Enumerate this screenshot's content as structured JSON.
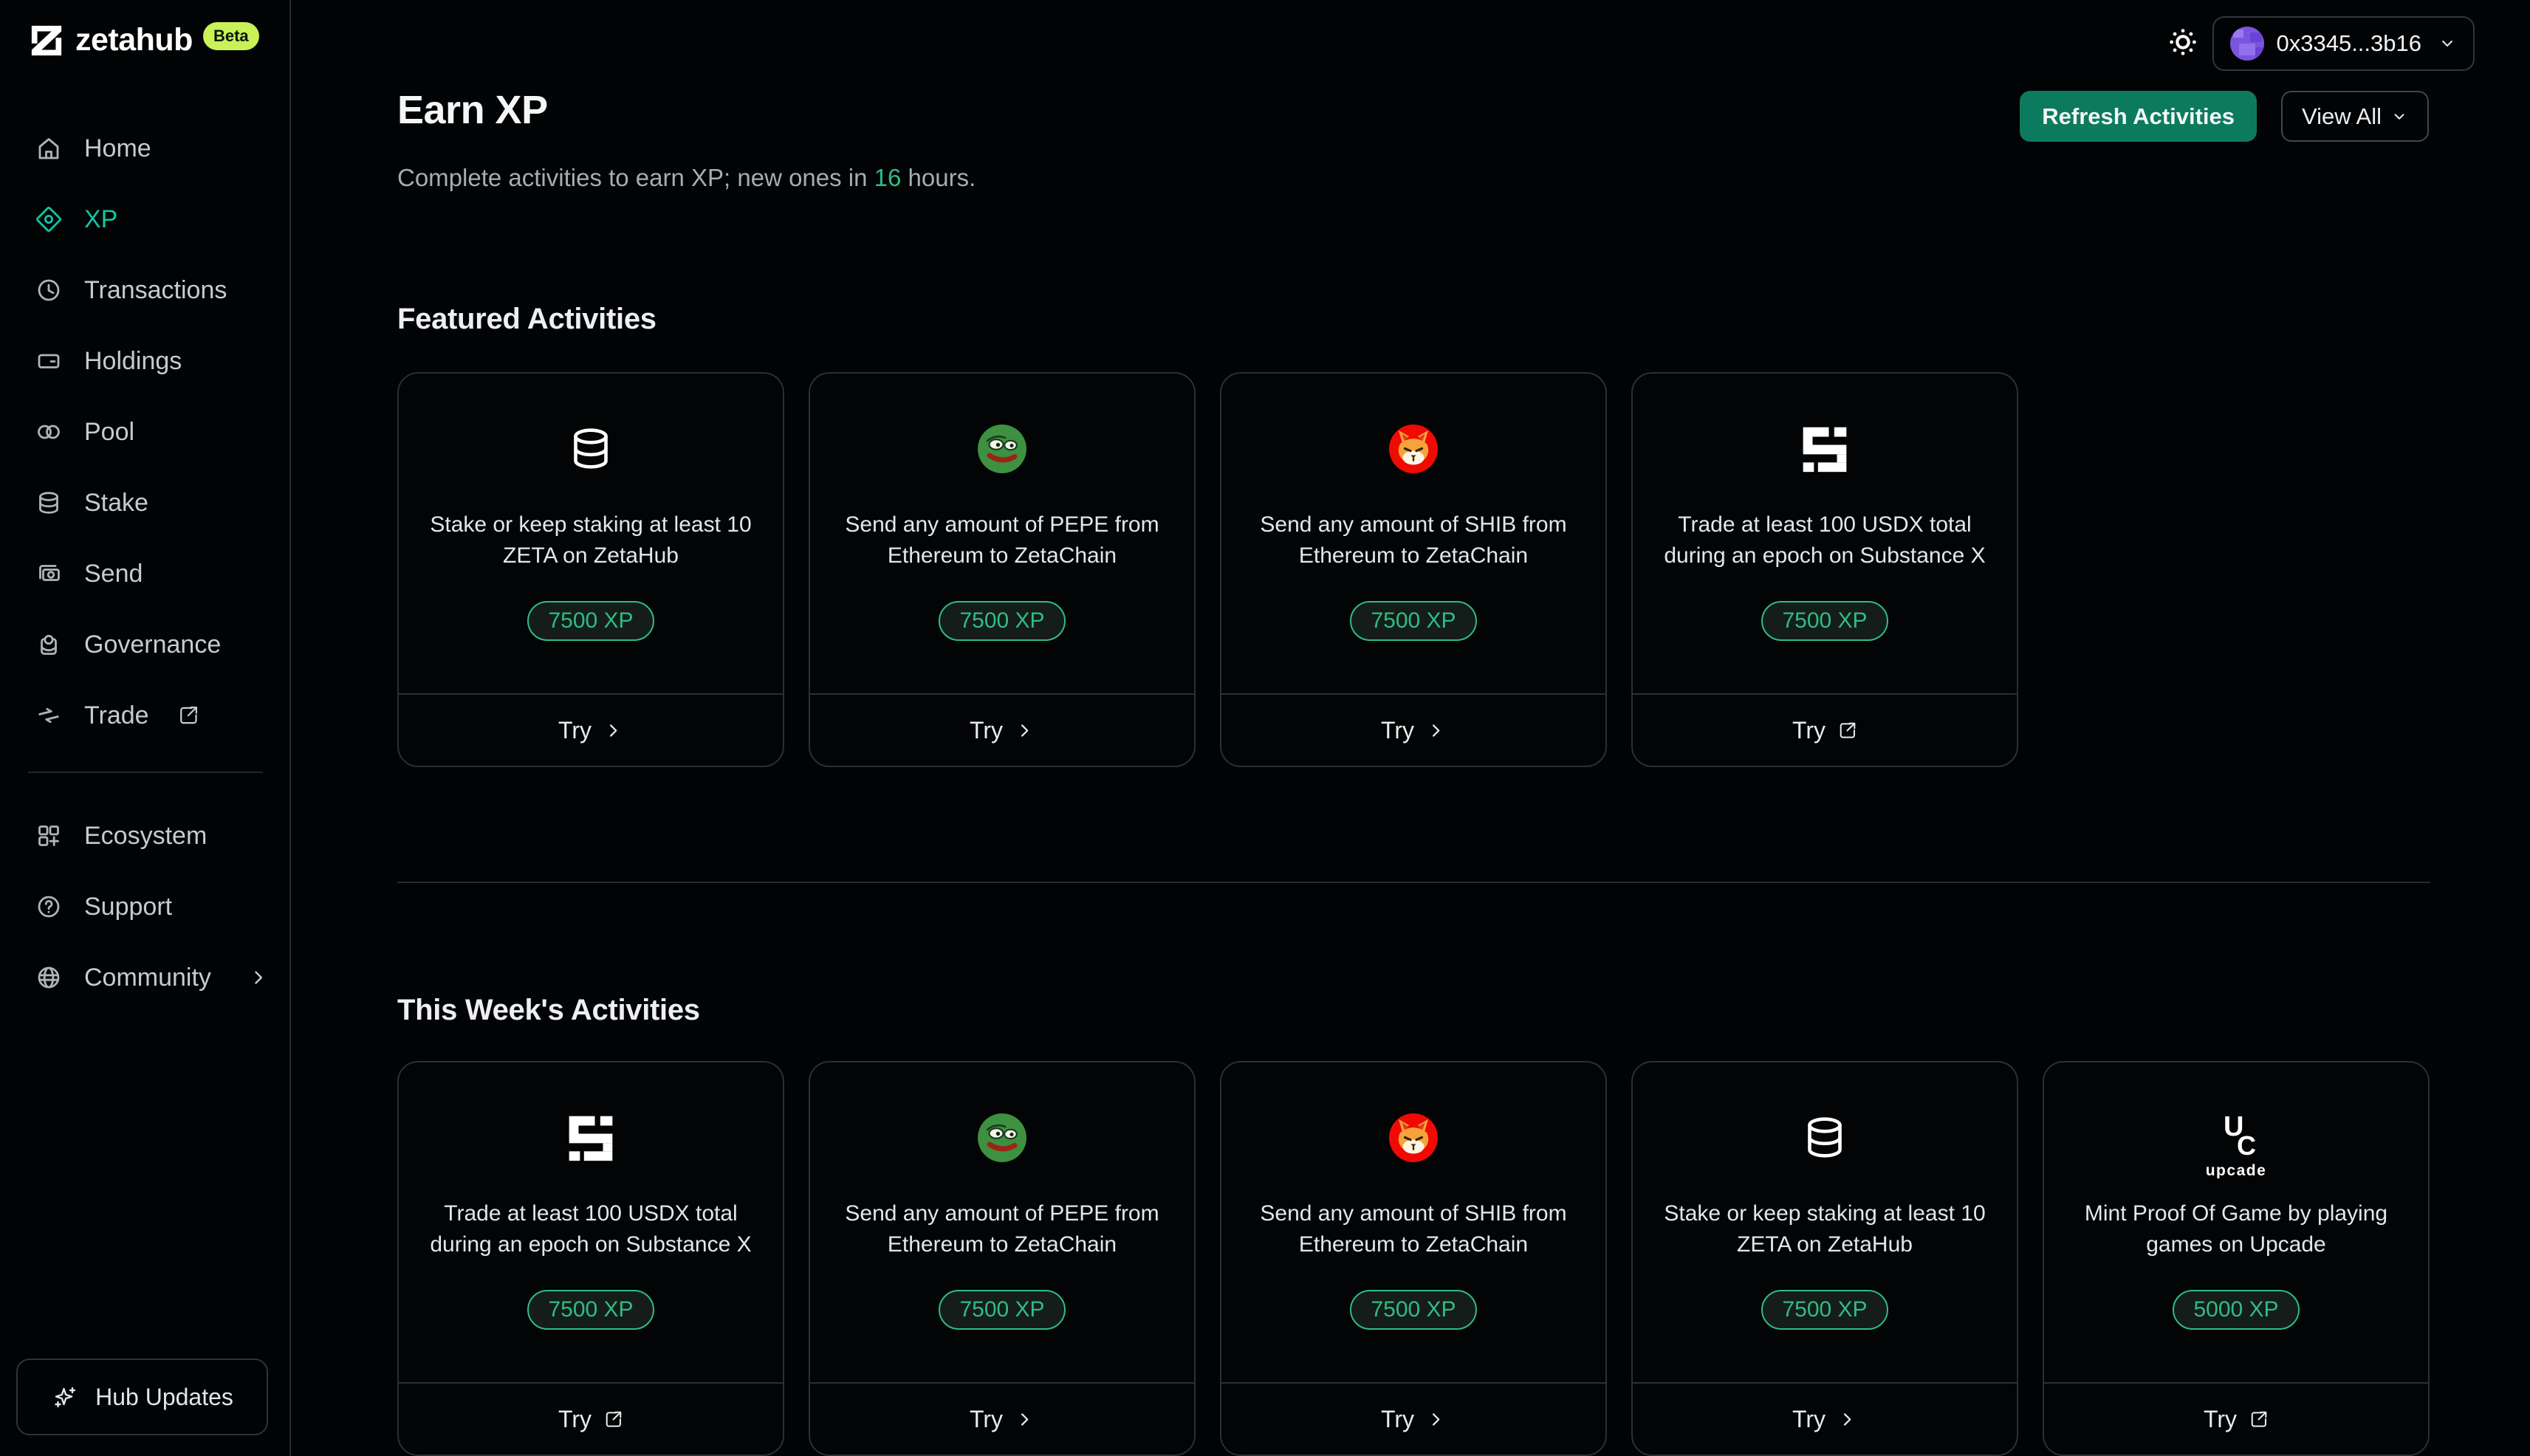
{
  "brand": {
    "name": "zetahub",
    "badge": "Beta"
  },
  "sidebar": {
    "primary": [
      {
        "label": "Home",
        "icon": "home-icon"
      },
      {
        "label": "XP",
        "icon": "xp-diamond-icon",
        "active": true
      },
      {
        "label": "Transactions",
        "icon": "clock-icon"
      },
      {
        "label": "Holdings",
        "icon": "wallet-card-icon"
      },
      {
        "label": "Pool",
        "icon": "pool-icon"
      },
      {
        "label": "Stake",
        "icon": "stake-database-icon"
      },
      {
        "label": "Send",
        "icon": "send-cash-icon"
      },
      {
        "label": "Governance",
        "icon": "governance-icon"
      },
      {
        "label": "Trade",
        "icon": "trade-arrows-icon",
        "external": true
      }
    ],
    "secondary": [
      {
        "label": "Ecosystem",
        "icon": "ecosystem-grid-icon"
      },
      {
        "label": "Support",
        "icon": "help-circle-icon"
      },
      {
        "label": "Community",
        "icon": "globe-icon",
        "chevron": true
      }
    ],
    "hub_button": {
      "label": "Hub Updates",
      "icon": "sparkles-icon"
    }
  },
  "topbar": {
    "theme_icon": "sun-icon",
    "wallet": {
      "address": "0x3345...3b16",
      "avatar_icon": "wallet-avatar"
    }
  },
  "page": {
    "title": "Earn XP",
    "subtitle_prefix": "Complete activities to earn XP; new ones in ",
    "subtitle_hours": "16",
    "subtitle_suffix": " hours.",
    "refresh_label": "Refresh Activities",
    "view_all_label": "View All"
  },
  "sections": [
    {
      "title": "Featured Activities",
      "cards": [
        {
          "icon": "database-icon",
          "title": "Stake or keep staking at least 10 ZETA on ZetaHub",
          "xp": "7500 XP",
          "cta": "Try",
          "external": false
        },
        {
          "icon": "pepe-icon",
          "title": "Send any amount of PEPE from Ethereum to ZetaChain",
          "xp": "7500 XP",
          "cta": "Try",
          "external": false
        },
        {
          "icon": "shib-icon",
          "title": "Send any amount of SHIB from Ethereum to ZetaChain",
          "xp": "7500 XP",
          "cta": "Try",
          "external": false
        },
        {
          "icon": "substance-x-icon",
          "title": "Trade at least 100 USDX total during an epoch on Substance X",
          "xp": "7500 XP",
          "cta": "Try",
          "external": true
        }
      ]
    },
    {
      "title": "This Week's Activities",
      "cards": [
        {
          "icon": "substance-x-icon",
          "title": "Trade at least 100 USDX total during an epoch on Substance X",
          "xp": "7500 XP",
          "cta": "Try",
          "external": true
        },
        {
          "icon": "pepe-icon",
          "title": "Send any amount of PEPE from Ethereum to ZetaChain",
          "xp": "7500 XP",
          "cta": "Try",
          "external": false
        },
        {
          "icon": "shib-icon",
          "title": "Send any amount of SHIB from Ethereum to ZetaChain",
          "xp": "7500 XP",
          "cta": "Try",
          "external": false
        },
        {
          "icon": "database-icon",
          "title": "Stake or keep staking at least 10 ZETA on ZetaHub",
          "xp": "7500 XP",
          "cta": "Try",
          "external": false
        },
        {
          "icon": "upcade-icon",
          "title": "Mint Proof Of Game by playing games on Upcade",
          "xp": "5000 XP",
          "cta": "Try",
          "external": true
        }
      ]
    }
  ],
  "colors": {
    "bg": "#010304",
    "accent": "#12C4A4",
    "badge_green": "#2EBD85",
    "button_green": "#0C7B5D",
    "lime": "#C9F158",
    "pepe_green": "#3D9140",
    "shib_red": "#EF0B04",
    "shib_orange": "#F5A43C",
    "avatar_purple": "#7B55DE"
  }
}
